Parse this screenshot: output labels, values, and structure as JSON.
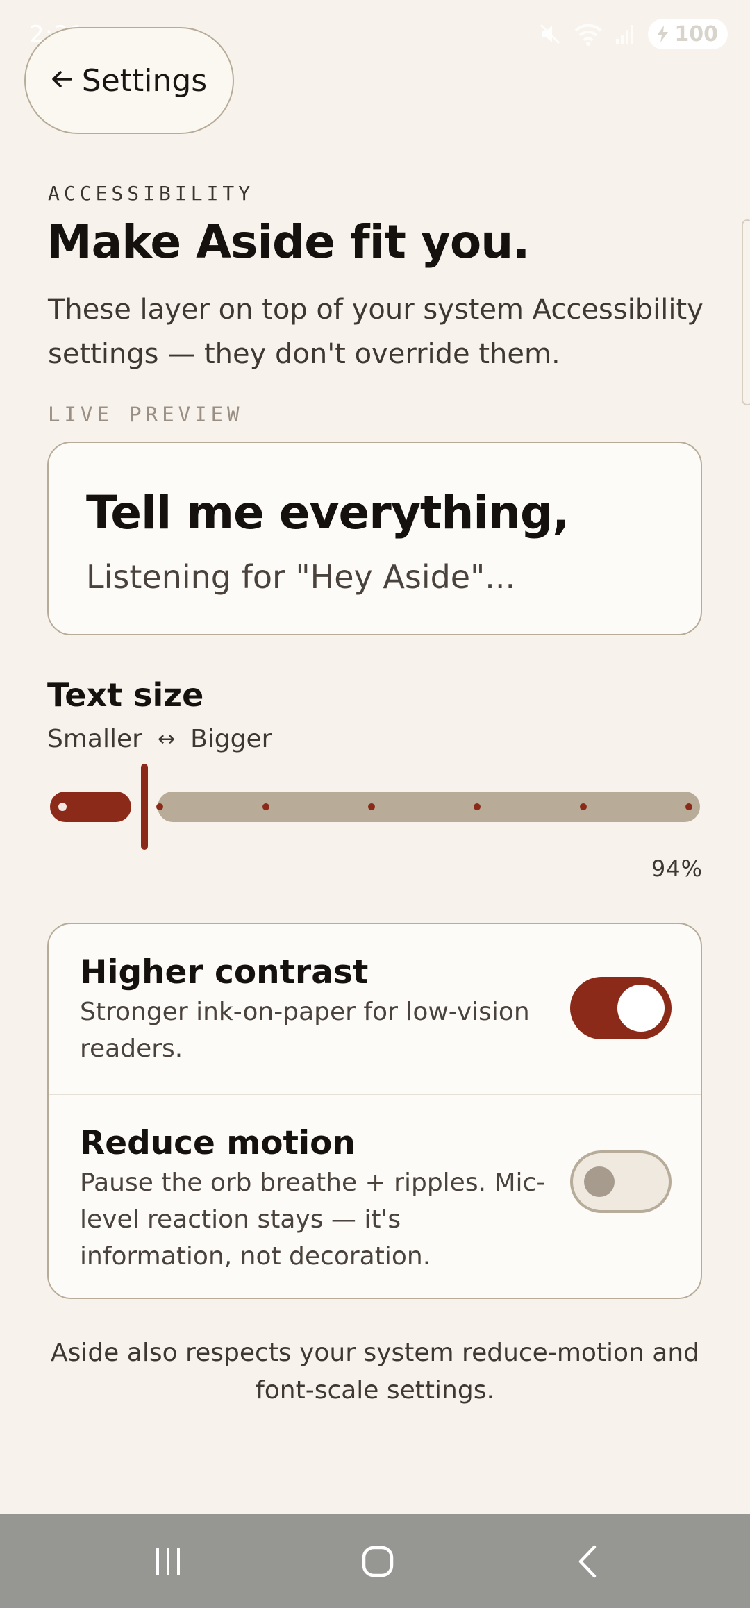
{
  "status_bar": {
    "time": "2:31",
    "battery": "100",
    "icons": [
      "mute-icon",
      "wifi-icon",
      "signal-icon",
      "battery-icon"
    ]
  },
  "header": {
    "back_label": "Settings",
    "back_icon": "arrow-left-icon"
  },
  "page": {
    "eyebrow": "ACCESSIBILITY",
    "title": "Make Aside fit you.",
    "subtitle": "These layer on top of your system Accessibility settings — they don't override them."
  },
  "preview": {
    "label": "LIVE PREVIEW",
    "headline": "Tell me everything,",
    "subline": "Listening for \"Hey Aside\"..."
  },
  "text_size": {
    "title": "Text size",
    "min_label": "Smaller",
    "arrow": "↔",
    "max_label": "Bigger",
    "value_label": "94%",
    "level_fraction": 0.14,
    "stops": 7
  },
  "toggles": [
    {
      "title": "Higher contrast",
      "description": "Stronger ink-on-paper for low-vision readers.",
      "enabled": true
    },
    {
      "title": "Reduce motion",
      "description": "Pause the orb breathe + ripples. Mic-level reaction stays — it's information, not decoration.",
      "enabled": false
    }
  ],
  "footer_note": "Aside also respects your system reduce-motion and font-scale settings.",
  "nav": {
    "recents_icon": "recents-icon",
    "home_icon": "home-icon",
    "back_icon": "back-icon"
  },
  "colors": {
    "background": "#F7F3EC",
    "accent": "#8B2A18",
    "track": "#B8AB97",
    "border": "#B7AC9A",
    "card": "#FDFBF7"
  }
}
